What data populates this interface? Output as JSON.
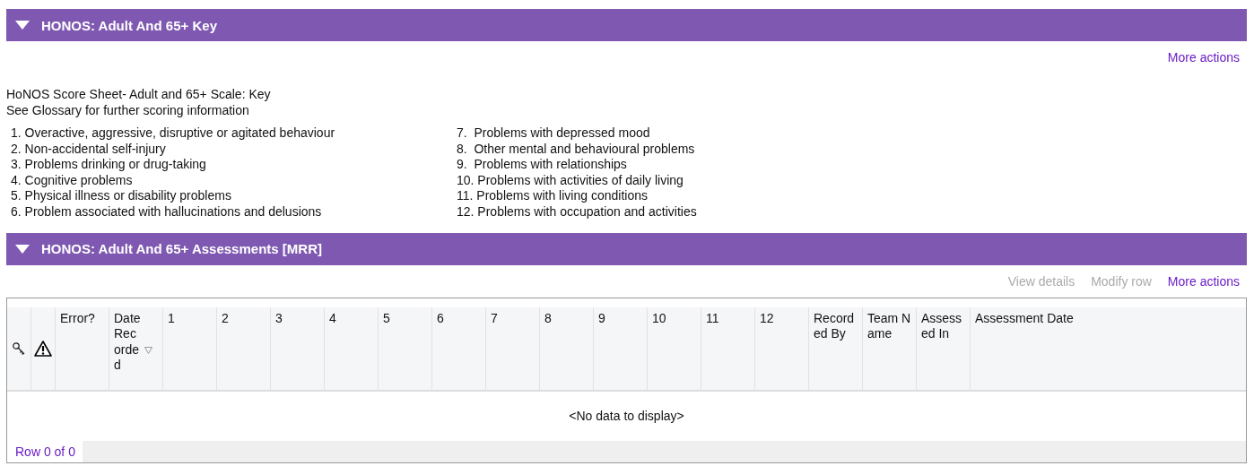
{
  "key_section": {
    "title": "HONOS: Adult And 65+ Key",
    "expanded": true,
    "actions": [
      {
        "label": "More actions",
        "disabled": false
      }
    ],
    "heading": "HoNOS Score Sheet- Adult and 65+ Scale: Key",
    "subheading": "See Glossary for further scoring information",
    "items_left": [
      "1. Overactive, aggressive, disruptive or agitated behaviour",
      "2. Non-accidental self-injury",
      "3. Problems drinking or drug-taking",
      "4. Cognitive problems",
      "5. Physical illness or disability problems",
      "6. Problem associated with hallucinations and delusions"
    ],
    "items_right": [
      "7.  Problems with depressed mood",
      "8.  Other mental and behavioural problems",
      "9.  Problems with relationships",
      "10. Problems with activities of daily living",
      "11. Problems with living conditions",
      "12. Problems with occupation and activities"
    ]
  },
  "assessments_section": {
    "title": "HONOS: Adult And 65+ Assessments [MRR]",
    "expanded": true,
    "actions": [
      {
        "label": "View details",
        "disabled": true
      },
      {
        "label": "Modify row",
        "disabled": true
      },
      {
        "label": "More actions",
        "disabled": false
      }
    ],
    "table": {
      "columns": [
        {
          "kind": "key-icon"
        },
        {
          "kind": "warning-icon"
        },
        {
          "kind": "text",
          "label": "Error?"
        },
        {
          "kind": "sorted",
          "label": "Date Recorded"
        },
        {
          "kind": "text",
          "label": "1"
        },
        {
          "kind": "text",
          "label": "2"
        },
        {
          "kind": "text",
          "label": "3"
        },
        {
          "kind": "text",
          "label": "4"
        },
        {
          "kind": "text",
          "label": "5"
        },
        {
          "kind": "text",
          "label": "6"
        },
        {
          "kind": "text",
          "label": "7"
        },
        {
          "kind": "text",
          "label": "8"
        },
        {
          "kind": "text",
          "label": "9"
        },
        {
          "kind": "text",
          "label": "10"
        },
        {
          "kind": "text",
          "label": "11"
        },
        {
          "kind": "text",
          "label": "12"
        },
        {
          "kind": "text",
          "label": "Recorded By"
        },
        {
          "kind": "text",
          "label": "Team Name"
        },
        {
          "kind": "text",
          "label": "Assessed In"
        },
        {
          "kind": "wide",
          "label": "Assessment Date"
        }
      ],
      "empty_message": "<No data to display>",
      "row_count": "Row 0 of 0"
    }
  }
}
